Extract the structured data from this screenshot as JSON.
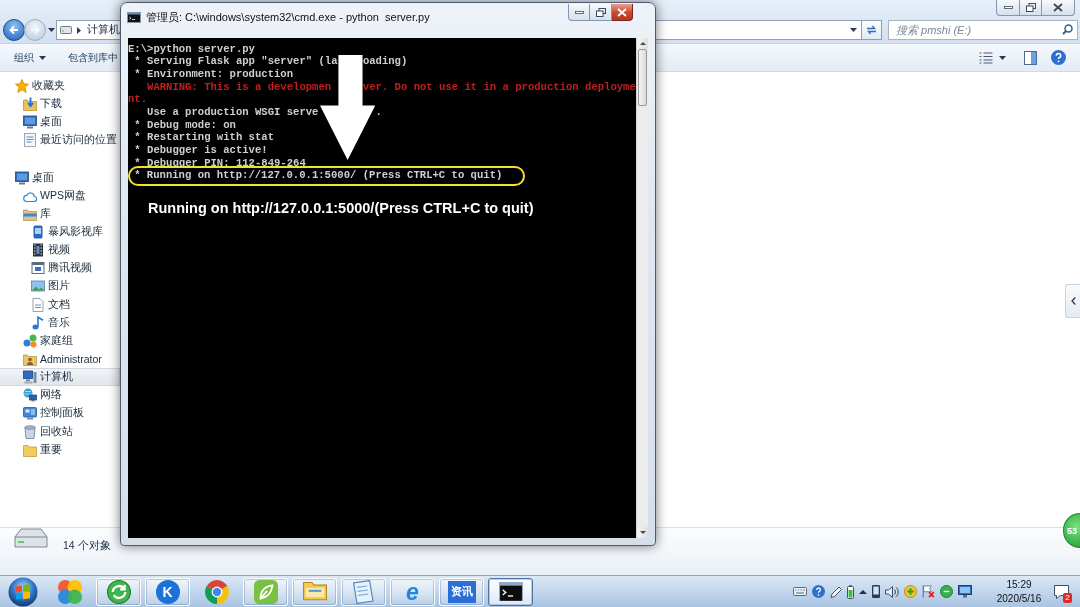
{
  "explorer": {
    "navigation": [
      {
        "kind": "back",
        "disabled": false
      },
      {
        "kind": "forward",
        "disabled": true
      }
    ],
    "address_bar": {
      "path": [
        "计算机"
      ]
    },
    "search": {
      "placeholder": "搜索 pmshi (E:)"
    },
    "toolbar": [
      {
        "label": "组织",
        "kind": "menu"
      },
      {
        "label": "包含到库中",
        "kind": "plain"
      }
    ],
    "sidebar": {
      "items": [
        {
          "label": "收藏夹",
          "kind": "favorites",
          "selected": false,
          "children": [
            {
              "label": "下载",
              "kind": "downloads",
              "selected": false
            },
            {
              "label": "桌面",
              "kind": "desktop",
              "selected": false
            },
            {
              "label": "最近访问的位置",
              "kind": "recent",
              "selected": false
            }
          ]
        },
        {
          "label": "桌面",
          "kind": "desktop",
          "selected": false,
          "children": [
            {
              "label": "WPS网盘",
              "kind": "cloud",
              "selected": false
            },
            {
              "label": "库",
              "kind": "library",
              "selected": false,
              "children": [
                {
                  "label": "暴风影视库",
                  "kind": "media",
                  "selected": false
                },
                {
                  "label": "视频",
                  "kind": "film",
                  "selected": false
                },
                {
                  "label": "腾讯视频",
                  "kind": "player",
                  "selected": false
                },
                {
                  "label": "图片",
                  "kind": "pictures",
                  "selected": false
                },
                {
                  "label": "文档",
                  "kind": "documents",
                  "selected": false
                },
                {
                  "label": "音乐",
                  "kind": "music",
                  "selected": false
                }
              ]
            },
            {
              "label": "家庭组",
              "kind": "homegroup",
              "selected": false
            },
            {
              "label": "Administrator",
              "kind": "user",
              "selected": false
            },
            {
              "label": "计算机",
              "kind": "computer",
              "selected": true
            },
            {
              "label": "网络",
              "kind": "network",
              "selected": false
            },
            {
              "label": "控制面板",
              "kind": "control-panel",
              "selected": false
            },
            {
              "label": "回收站",
              "kind": "recycle-bin",
              "selected": false
            },
            {
              "label": "重要",
              "kind": "folder",
              "selected": false
            }
          ]
        }
      ]
    },
    "status_bar": {
      "item_count": "14 个对象"
    }
  },
  "console_window": {
    "title": "管理员: C:\\windows\\system32\\cmd.exe - python  server.py",
    "lines": [
      {
        "kind": "output",
        "highlighted": false,
        "segments": [
          "E:\\>python server.py"
        ]
      },
      {
        "kind": "output",
        "highlighted": false,
        "segments": [
          " * Serving Flask app \"server\" (la",
          "oading)"
        ]
      },
      {
        "kind": "output",
        "highlighted": false,
        "segments": [
          " * Environment: production"
        ]
      },
      {
        "kind": "warning",
        "highlighted": false,
        "segments": [
          "   WARNING: This is a developmen",
          "ver. Do not use it in a production deployme"
        ]
      },
      {
        "kind": "warning",
        "highlighted": false,
        "segments": [
          "nt."
        ]
      },
      {
        "kind": "output",
        "highlighted": false,
        "segments": [
          "   Use a production WSGI serve",
          "."
        ]
      },
      {
        "kind": "output",
        "highlighted": false,
        "segments": [
          " * Debug mode: on"
        ]
      },
      {
        "kind": "output",
        "highlighted": false,
        "segments": [
          " * Restarting with stat"
        ]
      },
      {
        "kind": "output",
        "highlighted": false,
        "segments": [
          " * Debugger is active!"
        ]
      },
      {
        "kind": "output",
        "highlighted": false,
        "segments": [
          " * Debugger PIN: 112-849-264"
        ]
      },
      {
        "kind": "output",
        "highlighted": true,
        "segments": [
          " * Running on http://127.0.0.1:5000/ (Press CTRL+C to quit)"
        ]
      }
    ],
    "annotation": {
      "caption": "Running on http://127.0.0.1:5000/(Press CTRL+C to quit)"
    }
  },
  "floating_ball": {
    "label": "53"
  },
  "taskbar": {
    "apps": [
      {
        "kind": "petals",
        "running": false,
        "active": false
      },
      {
        "kind": "orb",
        "running": true,
        "active": false
      },
      {
        "kind": "letter-circle",
        "label": "K",
        "running": true,
        "active": false
      },
      {
        "kind": "wheel",
        "running": false,
        "active": false
      },
      {
        "kind": "leaf",
        "running": true,
        "active": false
      },
      {
        "kind": "folder",
        "running": true,
        "active": false
      },
      {
        "kind": "notebook",
        "running": true,
        "active": false
      },
      {
        "kind": "letter-logo",
        "label": "e",
        "running": true,
        "active": false
      },
      {
        "kind": "news",
        "label": "资讯",
        "running": true,
        "active": false
      },
      {
        "kind": "terminal",
        "running": true,
        "active": true
      }
    ],
    "clock": {
      "time": "15:29",
      "date": "2020/5/16"
    },
    "notifications": {
      "count": "2"
    }
  }
}
